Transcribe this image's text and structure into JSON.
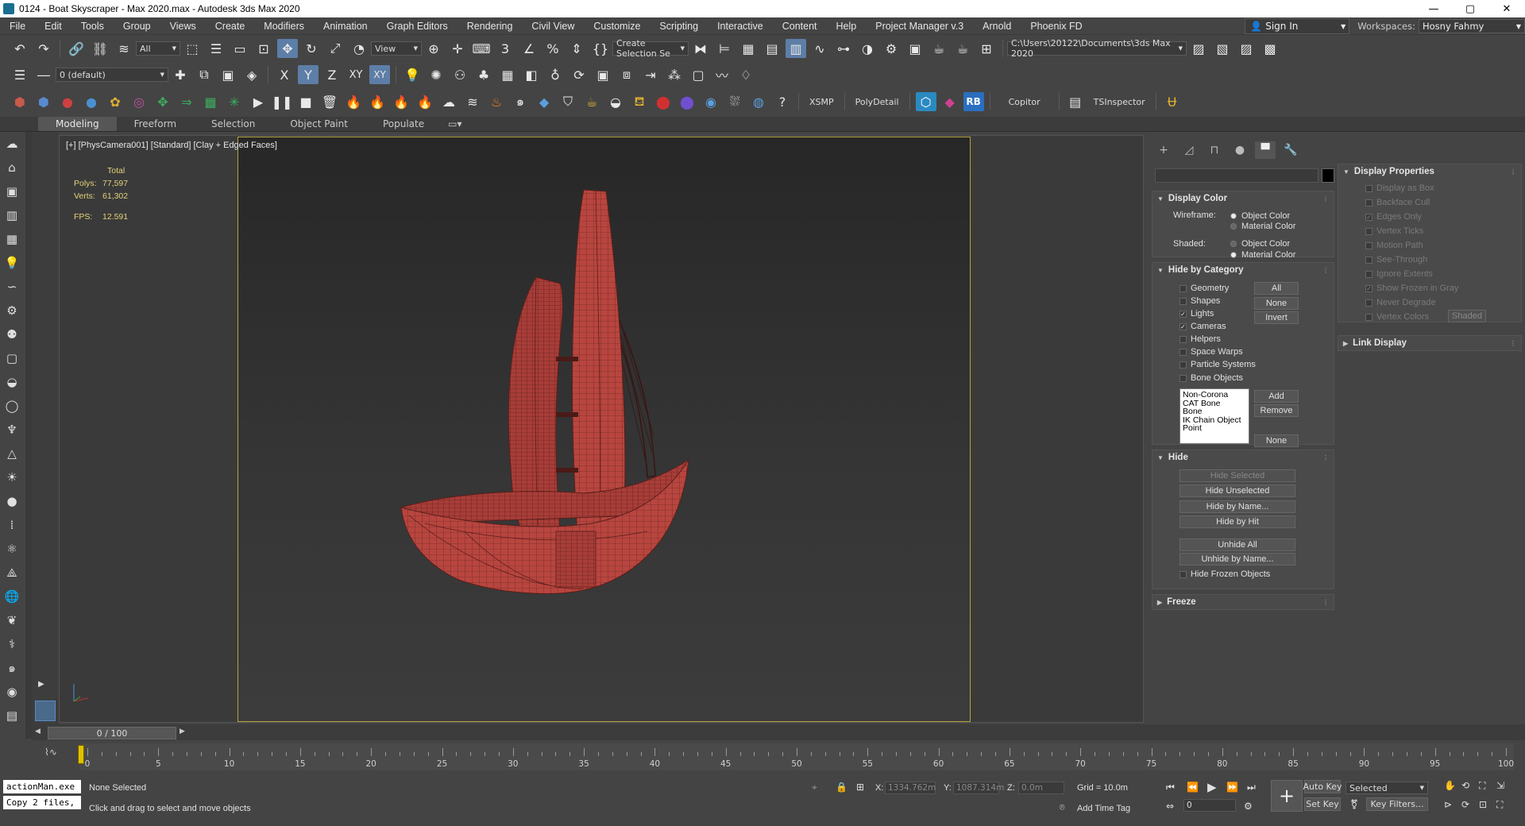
{
  "window": {
    "title": "0124 - Boat Skyscraper - Max 2020.max - Autodesk 3ds Max 2020",
    "controls": [
      "—",
      "▢",
      "✕"
    ]
  },
  "menu": {
    "items": [
      "File",
      "Edit",
      "Tools",
      "Group",
      "Views",
      "Create",
      "Modifiers",
      "Animation",
      "Graph Editors",
      "Rendering",
      "Civil View",
      "Customize",
      "Scripting",
      "Interactive",
      "Content",
      "Help",
      "Project Manager v.3",
      "Arnold",
      "Phoenix FD"
    ],
    "sign_in": "Sign In",
    "workspaces_label": "Workspaces:",
    "workspace_value": "Hosny Fahmy"
  },
  "toolbar": {
    "selection_filter": "All",
    "ref_coord": "View",
    "named_selection": "Create Selection Se",
    "project_path": "C:\\Users\\20122\\Documents\\3ds Max 2020",
    "layer": "0 (default)",
    "axis_x": "X",
    "axis_y": "Y",
    "axis_z": "Z",
    "axis_xy": "XY",
    "axis_xy2": "XY",
    "xsmp": "XSMP",
    "polydetail": "PolyDetail",
    "rb": "RB",
    "copitor": "Copitor",
    "tsinspector": "TSInspector"
  },
  "ribbon": {
    "tabs": [
      "Modeling",
      "Freeform",
      "Selection",
      "Object Paint",
      "Populate"
    ]
  },
  "viewport": {
    "label": "[+] [PhysCamera001] [Standard] [Clay + Edged Faces]",
    "stats_total": "Total",
    "polys_label": "Polys:",
    "polys_value": "77,597",
    "verts_label": "Verts:",
    "verts_value": "61,302",
    "fps_label": "FPS:",
    "fps_value": "12.591",
    "model_color": "#b8453f",
    "safe_frame_color": "#b6a23c"
  },
  "command_panel": {
    "display_color": {
      "title": "Display Color",
      "wireframe_label": "Wireframe:",
      "shaded_label": "Shaded:",
      "object_color": "Object Color",
      "material_color": "Material Color"
    },
    "hide_by_category": {
      "title": "Hide by Category",
      "items": [
        {
          "label": "Geometry",
          "checked": false
        },
        {
          "label": "Shapes",
          "checked": false
        },
        {
          "label": "Lights",
          "checked": true
        },
        {
          "label": "Cameras",
          "checked": true
        },
        {
          "label": "Helpers",
          "checked": false
        },
        {
          "label": "Space Warps",
          "checked": false
        },
        {
          "label": "Particle Systems",
          "checked": false
        },
        {
          "label": "Bone Objects",
          "checked": false
        }
      ],
      "all": "All",
      "none": "None",
      "invert": "Invert",
      "list": [
        "Non-Corona",
        "CAT Bone",
        "Bone",
        "IK Chain Object",
        "Point"
      ],
      "add": "Add",
      "remove": "Remove",
      "none2": "None"
    },
    "hide": {
      "title": "Hide",
      "hide_selected": "Hide Selected",
      "hide_unselected": "Hide Unselected",
      "hide_by_name": "Hide by Name...",
      "hide_by_hit": "Hide by Hit",
      "unhide_all": "Unhide All",
      "unhide_by_name": "Unhide by Name...",
      "hide_frozen": "Hide Frozen Objects"
    },
    "freeze": {
      "title": "Freeze"
    },
    "display_properties": {
      "title": "Display Properties",
      "items": [
        {
          "label": "Display as Box",
          "checked": false
        },
        {
          "label": "Backface Cull",
          "checked": false
        },
        {
          "label": "Edges Only",
          "checked": true
        },
        {
          "label": "Vertex Ticks",
          "checked": false
        },
        {
          "label": "Motion Path",
          "checked": false
        },
        {
          "label": "See-Through",
          "checked": false
        },
        {
          "label": "Ignore Extents",
          "checked": false
        },
        {
          "label": "Show Frozen in Gray",
          "checked": true
        },
        {
          "label": "Never Degrade",
          "checked": false
        },
        {
          "label": "Vertex Colors",
          "checked": false
        }
      ],
      "shaded_btn": "Shaded"
    },
    "link_display": {
      "title": "Link Display"
    }
  },
  "timeline": {
    "slider_text": "0 / 100",
    "ticks": [
      "0",
      "5",
      "10",
      "15",
      "20",
      "25",
      "30",
      "35",
      "40",
      "45",
      "50",
      "55",
      "60",
      "65",
      "70",
      "75",
      "80",
      "85",
      "90",
      "95",
      "100"
    ]
  },
  "status": {
    "macro1": "actionMan.exe",
    "macro2": "Copy 2 files,",
    "selection": "None Selected",
    "prompt": "Click and drag to select and move objects",
    "x_label": "X:",
    "x_value": "1334.762m",
    "y_label": "Y:",
    "y_value": "1087.314m",
    "z_label": "Z:",
    "z_value": "0.0m",
    "grid": "Grid = 10.0m",
    "add_time_tag": "Add Time Tag",
    "auto_key": "Auto Key",
    "set_key": "Set Key",
    "key_mode": "Selected",
    "key_filters": "Key Filters...",
    "frame": "0"
  }
}
